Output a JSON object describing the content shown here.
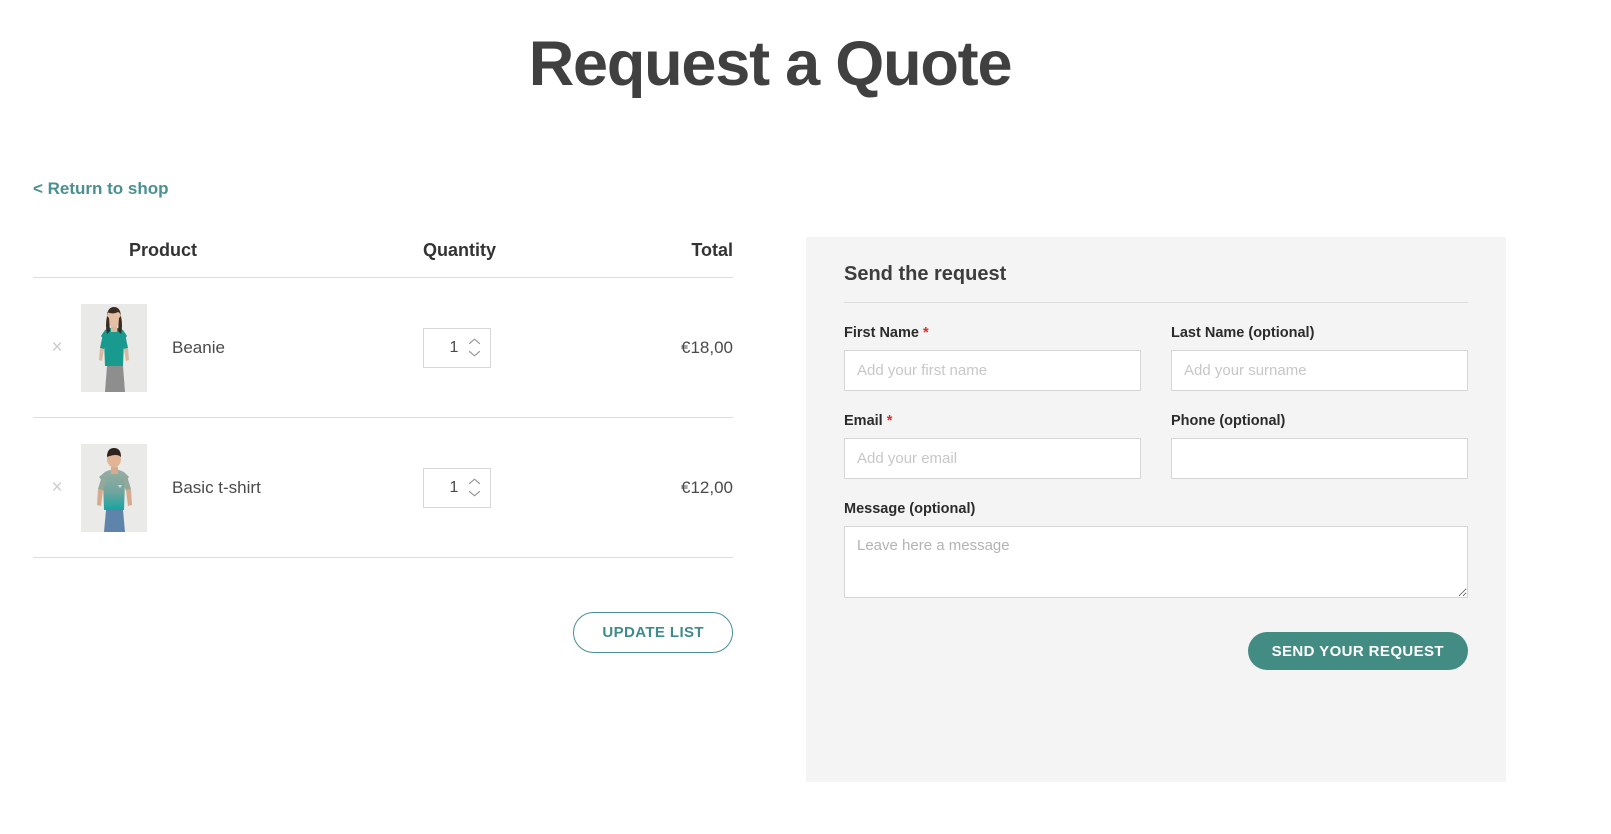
{
  "page": {
    "title": "Request a Quote",
    "return_link": "< Return to shop"
  },
  "table": {
    "headers": {
      "product": "Product",
      "quantity": "Quantity",
      "total": "Total"
    },
    "rows": [
      {
        "remove_icon": "×",
        "name": "Beanie",
        "quantity": "1",
        "total": "€18,00",
        "image_alt": "woman-wearing-teal-top"
      },
      {
        "remove_icon": "×",
        "name": "Basic t-shirt",
        "quantity": "1",
        "total": "€12,00",
        "image_alt": "man-wearing-gradient-tshirt"
      }
    ],
    "update_button": "UPDATE LIST"
  },
  "form": {
    "title": "Send the request",
    "first_name": {
      "label": "First Name",
      "required_mark": "*",
      "placeholder": "Add your first name",
      "value": ""
    },
    "last_name": {
      "label": "Last Name (optional)",
      "placeholder": "Add your surname",
      "value": ""
    },
    "email": {
      "label": "Email",
      "required_mark": "*",
      "placeholder": "Add your email",
      "value": ""
    },
    "phone": {
      "label": "Phone (optional)",
      "placeholder": "",
      "value": ""
    },
    "message": {
      "label": "Message (optional)",
      "placeholder": "Leave here a message",
      "value": ""
    },
    "submit_button": "SEND YOUR REQUEST"
  },
  "colors": {
    "teal": "#438c84",
    "link_teal": "#4a8f91",
    "panel_bg": "#f4f4f4",
    "required_red": "#e02b20",
    "title_gray": "#404040"
  }
}
